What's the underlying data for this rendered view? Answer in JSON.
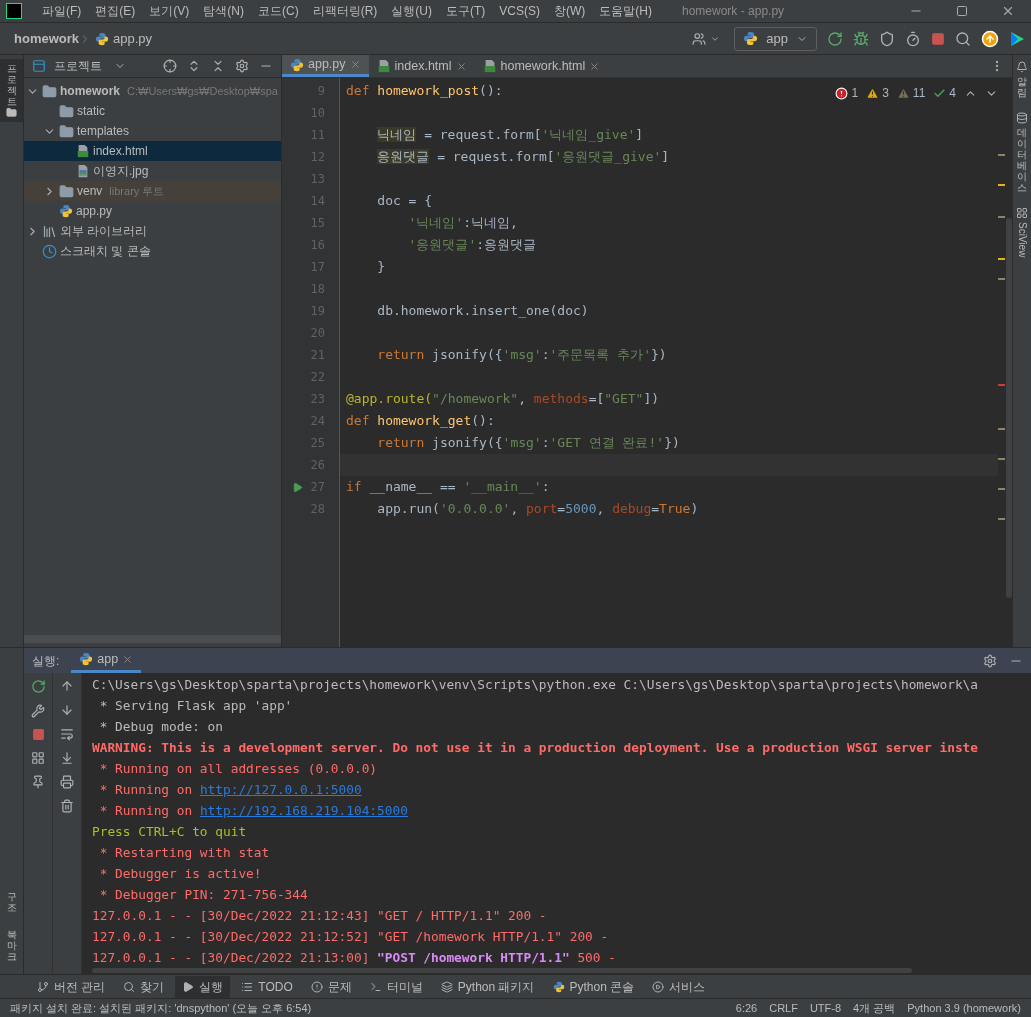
{
  "menu_bar": {
    "items": [
      "파일(F)",
      "편집(E)",
      "보기(V)",
      "탐색(N)",
      "코드(C)",
      "리팩터링(R)",
      "실행(U)",
      "도구(T)",
      "VCS(S)",
      "창(W)",
      "도움말(H)"
    ],
    "window_title": "homework - app.py"
  },
  "nav_bar": {
    "breadcrumbs": [
      "homework",
      "app.py"
    ],
    "run_config": "app"
  },
  "left_stripe": {
    "top": [
      {
        "label": "프로젝트",
        "selected": true
      }
    ],
    "bottom": [
      {
        "label": "구조",
        "selected": false
      },
      {
        "label": "북마크",
        "selected": false
      }
    ]
  },
  "project_panel": {
    "title": "프로젝트",
    "tree": [
      {
        "label": "homework",
        "note": "C:₩Users₩gs₩Desktop₩spa",
        "kind": "folder",
        "expanded": true,
        "selected": false,
        "children": [
          {
            "label": "static",
            "kind": "folder",
            "selected": false
          },
          {
            "label": "templates",
            "kind": "folder",
            "expanded": true,
            "selected": false,
            "children": [
              {
                "label": "index.html",
                "kind": "html",
                "selected": true
              },
              {
                "label": "이영지.jpg",
                "kind": "image",
                "selected": false
              }
            ]
          },
          {
            "label": "venv",
            "note": "library 루트",
            "kind": "library-root",
            "expanded": false,
            "selected": false
          },
          {
            "label": "app.py",
            "kind": "python",
            "selected": false
          }
        ]
      },
      {
        "label": "외부 라이브러리",
        "kind": "libraries",
        "expanded": false,
        "selected": false
      },
      {
        "label": "스크래치 및 콘솔",
        "kind": "scratches",
        "selected": false
      }
    ]
  },
  "editor": {
    "tabs": [
      {
        "label": "app.py",
        "kind": "python",
        "selected": true
      },
      {
        "label": "index.html",
        "kind": "html",
        "selected": false
      },
      {
        "label": "homework.html",
        "kind": "html",
        "selected": false
      }
    ],
    "inspections": [
      {
        "kind": "error",
        "count": "1"
      },
      {
        "kind": "warning",
        "count": "3"
      },
      {
        "kind": "weak-warning",
        "count": "11"
      },
      {
        "kind": "typo",
        "count": "4"
      }
    ],
    "lines": [
      {
        "number": "9",
        "segments": [
          {
            "text": "def ",
            "kind": "keyword"
          },
          {
            "text": "homework_post",
            "kind": "function"
          },
          {
            "text": "():",
            "kind": "plain"
          }
        ]
      },
      {
        "number": "10"
      },
      {
        "number": "11",
        "segments": [
          {
            "text": "    닉네임",
            "kind": "variable"
          },
          {
            "text": " = request.form[",
            "kind": "plain"
          },
          {
            "text": "'닉네임_give'",
            "kind": "string"
          },
          {
            "text": "]",
            "kind": "plain"
          }
        ]
      },
      {
        "number": "12",
        "segments": [
          {
            "text": "    응원댓글",
            "kind": "variable"
          },
          {
            "text": " = request.form[",
            "kind": "plain"
          },
          {
            "text": "'응원댓글_give'",
            "kind": "string"
          },
          {
            "text": "]",
            "kind": "plain"
          }
        ]
      },
      {
        "number": "13"
      },
      {
        "number": "14",
        "segments": [
          {
            "text": "    doc = {",
            "kind": "plain"
          }
        ]
      },
      {
        "number": "15",
        "segments": [
          {
            "text": "        '닉네임'",
            "kind": "string"
          },
          {
            "text": ":닉네임,",
            "kind": "plain"
          }
        ]
      },
      {
        "number": "16",
        "segments": [
          {
            "text": "        '응원댓글'",
            "kind": "string"
          },
          {
            "text": ":응원댓글",
            "kind": "plain"
          }
        ]
      },
      {
        "number": "17",
        "segments": [
          {
            "text": "    }",
            "kind": "plain"
          }
        ]
      },
      {
        "number": "18"
      },
      {
        "number": "19",
        "segments": [
          {
            "text": "    db.homework.insert_one(doc)",
            "kind": "plain"
          }
        ]
      },
      {
        "number": "20"
      },
      {
        "number": "21",
        "segments": [
          {
            "text": "    return",
            "kind": "keyword"
          },
          {
            "text": " jsonify({",
            "kind": "plain"
          },
          {
            "text": "'msg'",
            "kind": "string"
          },
          {
            "text": ":",
            "kind": "plain"
          },
          {
            "text": "'주문목록 추가'",
            "kind": "string"
          },
          {
            "text": "})",
            "kind": "plain"
          }
        ]
      },
      {
        "number": "22"
      },
      {
        "number": "23",
        "segments": [
          {
            "text": "@app.route(",
            "kind": "decorator"
          },
          {
            "text": "\"/homework\"",
            "kind": "string"
          },
          {
            "text": ", ",
            "kind": "plain"
          },
          {
            "text": "methods",
            "kind": "param"
          },
          {
            "text": "=[",
            "kind": "plain"
          },
          {
            "text": "\"GET\"",
            "kind": "string"
          },
          {
            "text": "])",
            "kind": "plain"
          }
        ]
      },
      {
        "number": "24",
        "segments": [
          {
            "text": "def ",
            "kind": "keyword"
          },
          {
            "text": "homework_get",
            "kind": "function"
          },
          {
            "text": "():",
            "kind": "plain"
          }
        ]
      },
      {
        "number": "25",
        "segments": [
          {
            "text": "    return",
            "kind": "keyword"
          },
          {
            "text": " jsonify({",
            "kind": "plain"
          },
          {
            "text": "'msg'",
            "kind": "string"
          },
          {
            "text": ":",
            "kind": "plain"
          },
          {
            "text": "'GET 연결 완료!'",
            "kind": "string"
          },
          {
            "text": "})",
            "kind": "plain"
          }
        ]
      },
      {
        "number": "26",
        "current": true
      },
      {
        "number": "27",
        "run_marker": true,
        "segments": [
          {
            "text": "if",
            "kind": "keyword"
          },
          {
            "text": " __name__ == ",
            "kind": "plain"
          },
          {
            "text": "'__main__'",
            "kind": "string"
          },
          {
            "text": ":",
            "kind": "plain"
          }
        ]
      },
      {
        "number": "28",
        "segments": [
          {
            "text": "    app.run(",
            "kind": "plain"
          },
          {
            "text": "'0.0.0.0'",
            "kind": "string"
          },
          {
            "text": ", ",
            "kind": "plain"
          },
          {
            "text": "port",
            "kind": "param"
          },
          {
            "text": "=",
            "kind": "plain"
          },
          {
            "text": "5000",
            "kind": "number"
          },
          {
            "text": ", ",
            "kind": "plain"
          },
          {
            "text": "debug",
            "kind": "param"
          },
          {
            "text": "=",
            "kind": "plain"
          },
          {
            "text": "True",
            "kind": "keyword"
          },
          {
            "text": ")",
            "kind": "plain"
          }
        ]
      }
    ]
  },
  "right_stripe": [
    {
      "label": "알림",
      "kind": "notifications"
    },
    {
      "label": "데이터베이스",
      "kind": "database"
    },
    {
      "label": "SciView",
      "kind": "sciview"
    }
  ],
  "run_panel": {
    "label": "실행:",
    "tab": "app",
    "lines": [
      {
        "segments": [
          {
            "text": "C:\\Users\\gs\\Desktop\\sparta\\projects\\homework\\venv\\Scripts\\python.exe C:\\Users\\gs\\Desktop\\sparta\\projects\\homework\\a",
            "kind": "plain"
          }
        ]
      },
      {
        "segments": [
          {
            "text": " * Serving Flask app 'app'",
            "kind": "plain"
          }
        ]
      },
      {
        "segments": [
          {
            "text": " * Debug mode: on",
            "kind": "plain"
          }
        ]
      },
      {
        "segments": [
          {
            "text": "WARNING: This is a development server. Do not use it in a production deployment. Use a production WSGI server inste",
            "kind": "error-bold"
          }
        ]
      },
      {
        "segments": [
          {
            "text": " * Running on all addresses (0.0.0.0)",
            "kind": "error"
          }
        ]
      },
      {
        "segments": [
          {
            "text": " * Running on ",
            "kind": "error"
          },
          {
            "text": "http://127.0.0.1:5000",
            "kind": "link"
          }
        ]
      },
      {
        "segments": [
          {
            "text": " * Running on ",
            "kind": "error"
          },
          {
            "text": "http://192.168.219.104:5000",
            "kind": "link"
          }
        ]
      },
      {
        "segments": [
          {
            "text": "Press CTRL+C to quit",
            "kind": "warn"
          }
        ]
      },
      {
        "segments": [
          {
            "text": " * Restarting with stat",
            "kind": "error"
          }
        ]
      },
      {
        "segments": [
          {
            "text": " * Debugger is active!",
            "kind": "error"
          }
        ]
      },
      {
        "segments": [
          {
            "text": " * Debugger PIN: 271-756-344",
            "kind": "error"
          }
        ]
      },
      {
        "segments": [
          {
            "text": "127.0.0.1 - - [30/Dec/2022 21:12:43] \"GET / HTTP/1.1\" 200 -",
            "kind": "error"
          }
        ]
      },
      {
        "segments": [
          {
            "text": "127.0.0.1 - - [30/Dec/2022 21:12:52] \"GET /homework HTTP/1.1\" 200 -",
            "kind": "error"
          }
        ]
      },
      {
        "segments": [
          {
            "text": "127.0.0.1 - - [30/Dec/2022 21:13:00] ",
            "kind": "error"
          },
          {
            "text": "\"POST /homework HTTP/1.1\"",
            "kind": "purple"
          },
          {
            "text": " 500 -",
            "kind": "error"
          }
        ]
      }
    ]
  },
  "tool_bar": [
    {
      "label": "버전 관리",
      "kind": "vcs",
      "selected": false
    },
    {
      "label": "찾기",
      "kind": "find",
      "selected": false
    },
    {
      "label": "실행",
      "kind": "run",
      "selected": true
    },
    {
      "label": "TODO",
      "kind": "todo",
      "selected": false
    },
    {
      "label": "문제",
      "kind": "problems",
      "selected": false
    },
    {
      "label": "터미널",
      "kind": "terminal",
      "selected": false
    },
    {
      "label": "Python 패키지",
      "kind": "packages",
      "selected": false
    },
    {
      "label": "Python 콘솔",
      "kind": "console",
      "selected": false
    },
    {
      "label": "서비스",
      "kind": "services",
      "selected": false
    }
  ],
  "status_bar": {
    "message": "패키지 설치 완료: 설치된 패키지: 'dnspython' (오늘 오후 6:54)",
    "items": [
      "6:26",
      "CRLF",
      "UTF-8",
      "4개 공백",
      "Python 3.9 (homework)"
    ]
  }
}
